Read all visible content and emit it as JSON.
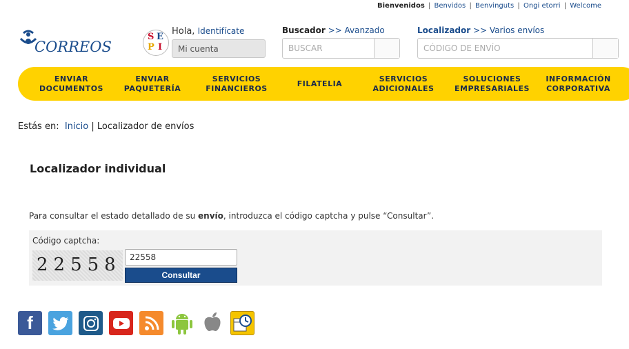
{
  "lang_bar": {
    "current": "Bienvenidos",
    "links": [
      "Benvidos",
      "Benvinguts",
      "Ongi etorri",
      "Welcome"
    ]
  },
  "brand": {
    "name": "CORREOS",
    "sepi_letters": [
      "S",
      "E",
      "P",
      "I"
    ]
  },
  "account": {
    "greeting": "Hola,",
    "login_link": "Identifícate",
    "my_account": "Mi cuenta"
  },
  "search": {
    "title": "Buscador",
    "advanced": ">> Avanzado",
    "placeholder": "BUSCAR"
  },
  "locator": {
    "title": "Localizador",
    "multi": ">> Varios envíos",
    "placeholder": "CÓDIGO DE ENVÍO"
  },
  "nav": [
    "ENVIAR\nDOCUMENTOS",
    "ENVIAR\nPAQUETERÍA",
    "SERVICIOS\nFINANCIEROS",
    "FILATELIA",
    "SERVICIOS\nADICIONALES",
    "SOLUCIONES\nEMPRESARIALES",
    "INFORMACIÓN\nCORPORATIVA"
  ],
  "breadcrumb": {
    "prefix": "Estás en:",
    "home": "Inicio",
    "separator": "|",
    "current": "Localizador de envíos"
  },
  "page_title": "Localizador individual",
  "instructions": {
    "before": "Para consultar el estado detallado de su ",
    "bold": "envío",
    "after": ", introduzca el código captcha y pulse “Consultar”."
  },
  "captcha": {
    "label": "Código captcha:",
    "image_text": "22558",
    "input_value": "22558",
    "button": "Consultar"
  },
  "social": [
    "facebook-icon",
    "twitter-icon",
    "instagram-icon",
    "youtube-icon",
    "rss-icon",
    "android-icon",
    "apple-icon",
    "schedule-icon"
  ],
  "colors": {
    "brand_blue": "#1a4c8c",
    "nav_yellow": "#ffd200"
  }
}
